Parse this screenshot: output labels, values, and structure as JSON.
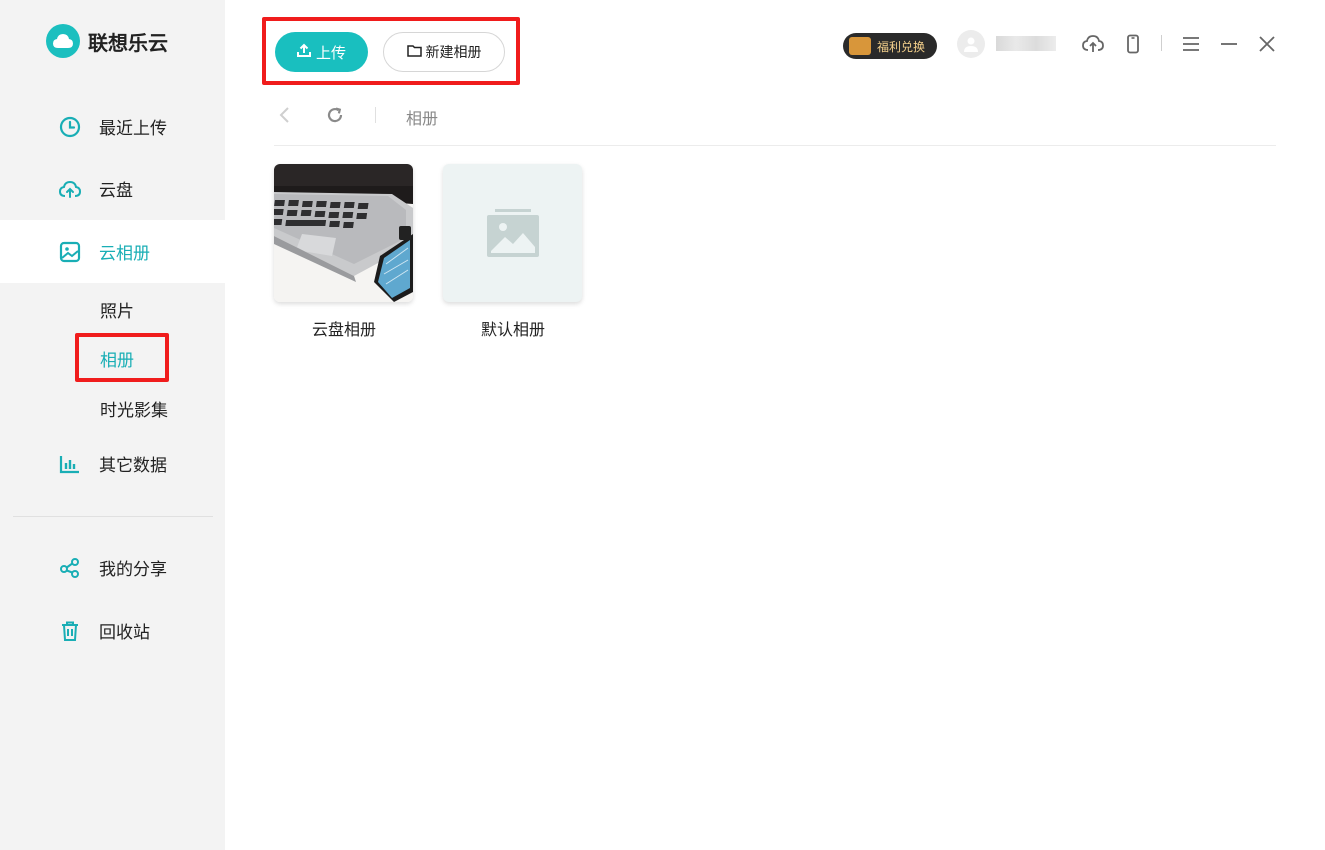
{
  "app": {
    "name": "联想乐云"
  },
  "sidebar": {
    "items": [
      {
        "label": "最近上传",
        "icon": "clock-icon"
      },
      {
        "label": "云盘",
        "icon": "cloud-upload-icon"
      },
      {
        "label": "云相册",
        "icon": "image-icon"
      },
      {
        "label": "其它数据",
        "icon": "bar-chart-icon"
      },
      {
        "label": "我的分享",
        "icon": "share-icon"
      },
      {
        "label": "回收站",
        "icon": "trash-icon"
      }
    ],
    "album_sub": [
      "照片",
      "相册",
      "时光影集"
    ],
    "active_item": "云相册",
    "active_sub": "相册"
  },
  "toolbar": {
    "upload_label": "上传",
    "new_album_label": "新建相册",
    "welfare_label": "福利兑换"
  },
  "breadcrumb": {
    "current": "相册"
  },
  "albums": [
    {
      "name": "云盘相册",
      "cover": "laptop-photo"
    },
    {
      "name": "默认相册",
      "cover": "placeholder-image-icon"
    }
  ],
  "colors": {
    "accent": "#19bfbf",
    "sidebar_bg": "#f3f3f3",
    "highlight": "#f01c1c"
  }
}
